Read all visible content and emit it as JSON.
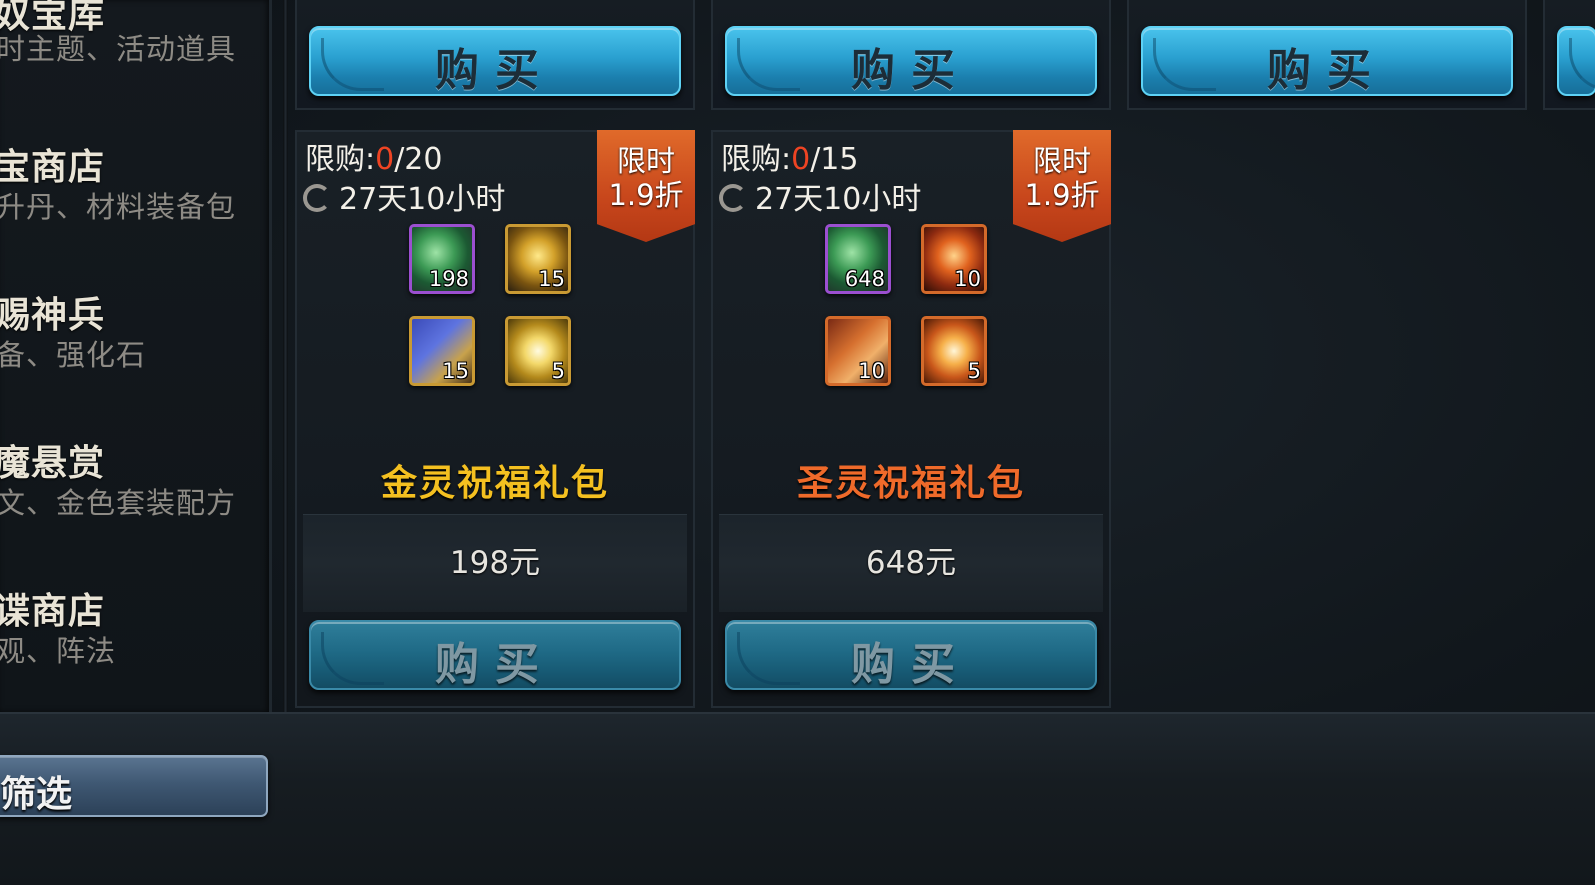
{
  "sidebar": {
    "items": [
      {
        "title": "奴宝库",
        "subtitle": "时主题、活动道具"
      },
      {
        "title": "宝商店",
        "subtitle": "升丹、材料装备包"
      },
      {
        "title": "赐神兵",
        "subtitle": "备、强化石"
      },
      {
        "title": "魔悬赏",
        "subtitle": "文、金色套装配方"
      },
      {
        "title": "谍商店",
        "subtitle": "观、阵法"
      }
    ],
    "filter_label": "筛选"
  },
  "top_row": {
    "buy_labels": [
      "购买",
      "购买",
      "购买"
    ]
  },
  "cards": [
    {
      "limit_prefix": "限购:",
      "limit_current": "0",
      "limit_total": "/20",
      "timer": "27天10小时",
      "ribbon_line1": "限时",
      "ribbon_line2": "1.9折",
      "items": [
        {
          "icon": "jade-coin-icon",
          "count": "198"
        },
        {
          "icon": "gold-gift-box-icon",
          "count": "15"
        },
        {
          "icon": "blue-scroll-icon",
          "count": "15"
        },
        {
          "icon": "golden-swirl-icon",
          "count": "5"
        }
      ],
      "name": "金灵祝福礼包",
      "name_color": "#f4c020",
      "price": "198元",
      "buy_label": "购买"
    },
    {
      "limit_prefix": "限购:",
      "limit_current": "0",
      "limit_total": "/15",
      "timer": "27天10小时",
      "ribbon_line1": "限时",
      "ribbon_line2": "1.9折",
      "items": [
        {
          "icon": "jade-coin-icon",
          "count": "648"
        },
        {
          "icon": "fire-crate-icon",
          "count": "10"
        },
        {
          "icon": "red-scroll-icon",
          "count": "10"
        },
        {
          "icon": "fire-swirl-icon",
          "count": "5"
        }
      ],
      "name": "圣灵祝福礼包",
      "name_color": "#ef6a2a",
      "price": "648元",
      "buy_label": "购买"
    }
  ],
  "colors": {
    "button_blue": "#2aa0d0",
    "limit_red": "#ee4423",
    "ribbon_orange": "#c8471c"
  }
}
